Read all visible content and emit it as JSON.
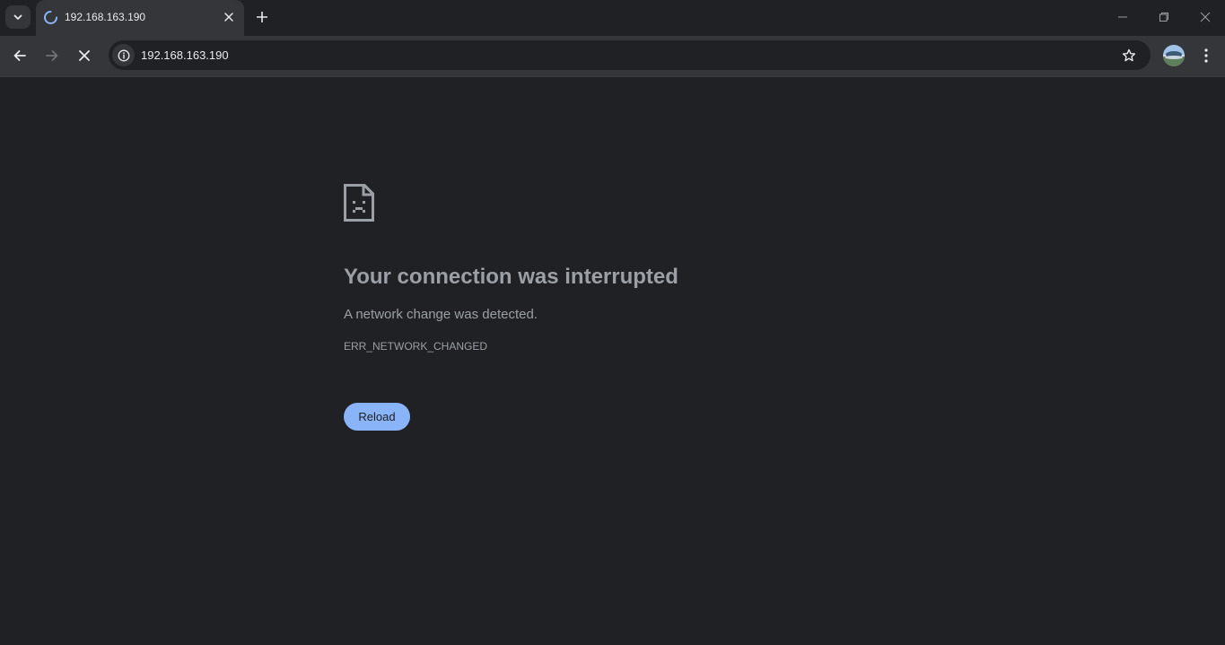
{
  "browser": {
    "tab": {
      "title": "192.168.163.190",
      "loading": true
    },
    "address_bar": {
      "url": "192.168.163.190"
    },
    "icons": {
      "tab_search": "chevron-down-icon",
      "tab_close": "close-icon",
      "new_tab": "plus-icon",
      "back": "arrow-left-icon",
      "forward": "arrow-right-icon",
      "stop": "close-icon",
      "site_info": "info-icon",
      "bookmark": "star-icon",
      "menu": "more-vert-icon"
    },
    "colors": {
      "background": "#202124",
      "toolbar": "#35363a",
      "accent": "#8ab4f8",
      "text_secondary": "#9aa0a6"
    }
  },
  "error_page": {
    "heading": "Your connection was interrupted",
    "description": "A network change was detected.",
    "error_code": "ERR_NETWORK_CHANGED",
    "reload_label": "Reload",
    "icon": "sad-page-icon"
  }
}
